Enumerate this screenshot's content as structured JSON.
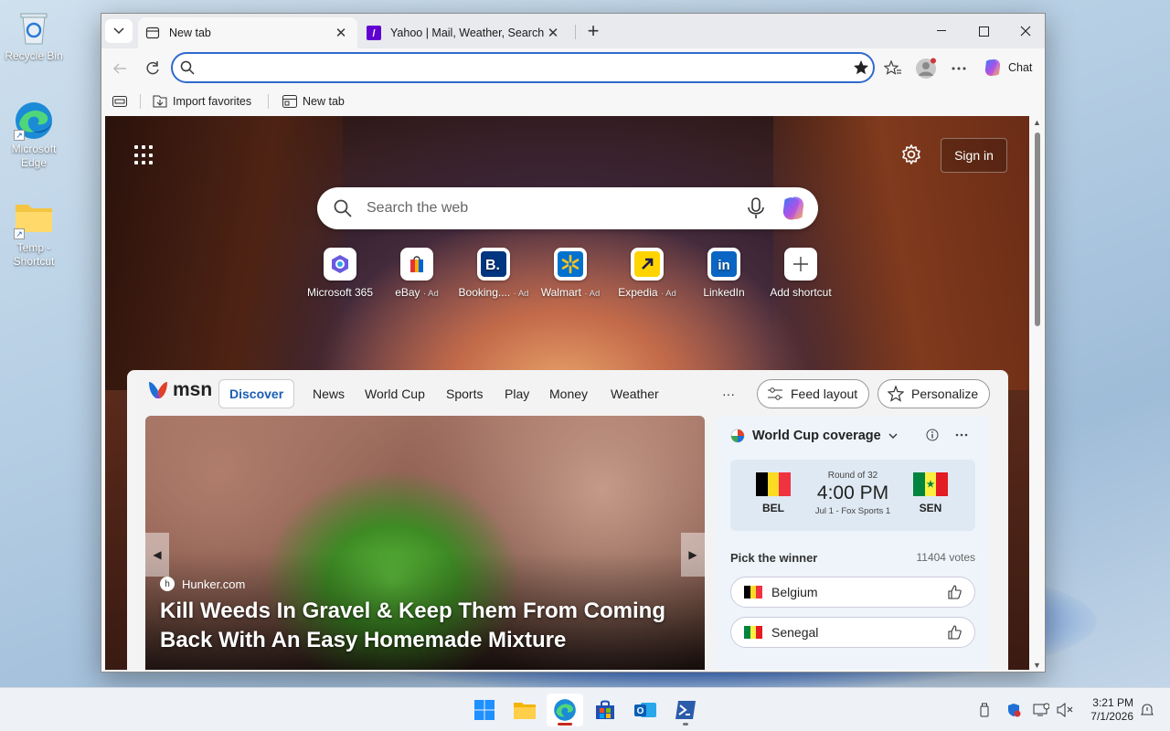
{
  "desktop": {
    "icons": [
      {
        "label": "Recycle Bin"
      },
      {
        "label": "Microsoft Edge"
      },
      {
        "label": "Temp - Shortcut"
      }
    ]
  },
  "browser": {
    "tabs": [
      {
        "title": "New tab",
        "active": true
      },
      {
        "title": "Yahoo | Mail, Weather, Search, Politics",
        "active": false
      }
    ],
    "address": {
      "value": "",
      "placeholder": ""
    },
    "chat_label": "Chat",
    "favorites_bar": [
      {
        "label": "Import favorites"
      },
      {
        "label": "New tab"
      }
    ]
  },
  "newtab": {
    "sign_in_label": "Sign in",
    "search_placeholder": "Search the web",
    "shortcuts": [
      {
        "label": "Microsoft 365",
        "ad": ""
      },
      {
        "label": "eBay",
        "ad": "· Ad"
      },
      {
        "label": "Booking....",
        "ad": "· Ad"
      },
      {
        "label": "Walmart",
        "ad": "· Ad"
      },
      {
        "label": "Expedia",
        "ad": "· Ad"
      },
      {
        "label": "LinkedIn",
        "ad": ""
      },
      {
        "label": "Add shortcut",
        "ad": ""
      }
    ]
  },
  "feed": {
    "brand": "msn",
    "tabs": [
      "Discover",
      "News",
      "World Cup",
      "Sports",
      "Play",
      "Money",
      "Weather"
    ],
    "more_label": "···",
    "feed_layout_label": "Feed layout",
    "personalize_label": "Personalize",
    "hero": {
      "source": "Hunker.com",
      "title": "Kill Weeds In Gravel & Keep Them From Coming Back With An Easy Homemade Mixture"
    },
    "worldcup": {
      "heading": "World Cup coverage",
      "round": "Round of 32",
      "time": "4:00 PM",
      "info": "Jul 1 - Fox Sports 1",
      "home_code": "BEL",
      "away_code": "SEN",
      "pick_label": "Pick the winner",
      "votes": "11404 votes",
      "options": [
        "Belgium",
        "Senegal"
      ]
    }
  },
  "taskbar": {
    "time": "3:21 PM",
    "date": "7/1/2026"
  },
  "colors": {
    "accent": "#2f6ad0",
    "belgium": [
      "#000000",
      "#fdda24",
      "#ef3340"
    ],
    "senegal": [
      "#00853f",
      "#fdef42",
      "#e31b23"
    ]
  }
}
